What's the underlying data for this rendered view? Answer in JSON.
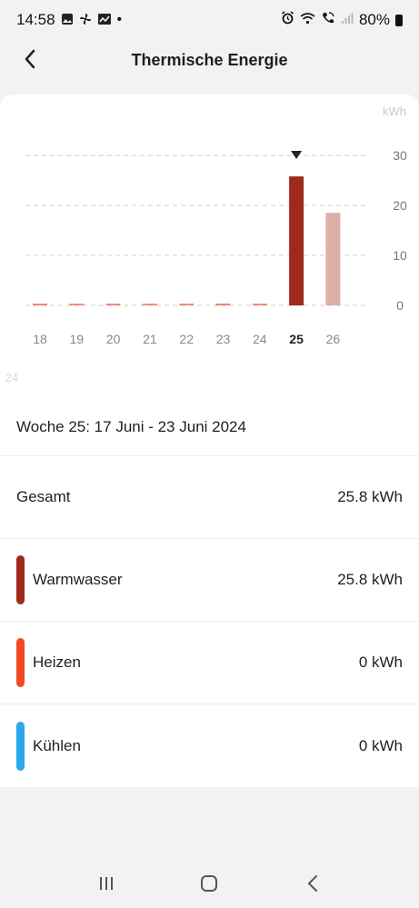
{
  "status_bar": {
    "time": "14:58",
    "battery": "80%",
    "icons_left": [
      "gallery-icon",
      "fan-icon",
      "image-icon",
      "dot-icon"
    ],
    "icons_right": [
      "alarm-icon",
      "wifi-icon",
      "wifi-call-icon",
      "signal-icon",
      "battery-icon"
    ]
  },
  "header": {
    "title": "Thermische Energie",
    "back_icon": "chevron-left-icon"
  },
  "chart_data": {
    "type": "bar",
    "categories": [
      "18",
      "19",
      "20",
      "21",
      "22",
      "23",
      "24",
      "25",
      "26"
    ],
    "values": [
      0,
      0,
      0,
      0,
      0,
      0,
      0,
      25.8,
      18.5
    ],
    "selected_category": "25",
    "unit_label": "kWh",
    "ylim": [
      0,
      30
    ],
    "yticks": [
      "0",
      "10",
      "20",
      "30"
    ],
    "grid": true,
    "colors": {
      "bar": "#9e2a1c",
      "bar_faded": "#dcaea6",
      "zero_line": "#f06a4e",
      "grid": "#cfcfcf"
    },
    "partial_label": "24"
  },
  "week": {
    "label": "Woche 25: 17 Juni - 23 Juni 2024"
  },
  "summary": {
    "total_label": "Gesamt",
    "total_value": "25.8 kWh",
    "items": [
      {
        "label": "Warmwasser",
        "value": "25.8 kWh",
        "color": "#9e2a1c"
      },
      {
        "label": "Heizen",
        "value": "0 kWh",
        "color": "#f24a23"
      },
      {
        "label": "Kühlen",
        "value": "0 kWh",
        "color": "#29a8ee"
      }
    ]
  },
  "nav": {
    "icons": [
      "recent-apps-icon",
      "home-icon",
      "back-icon"
    ]
  }
}
